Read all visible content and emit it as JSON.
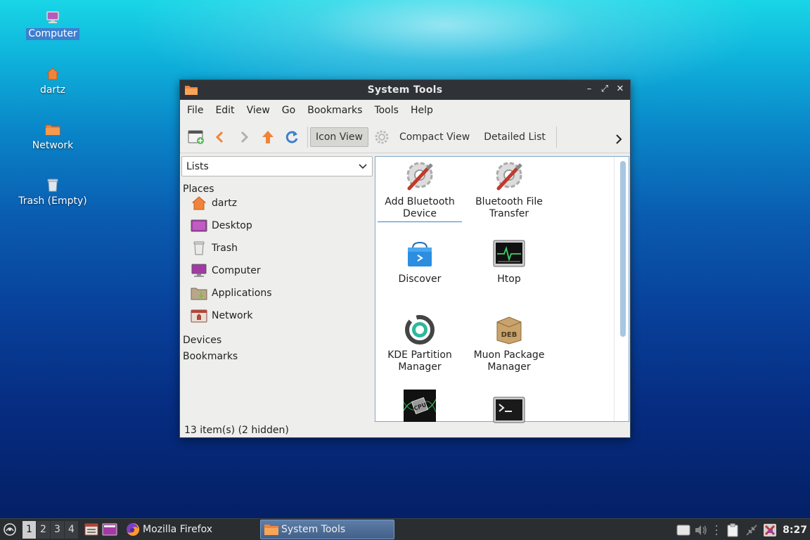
{
  "desktop": {
    "icons": [
      {
        "label": "Computer",
        "icon": "computer-icon",
        "selected": true
      },
      {
        "label": "dartz",
        "icon": "home-folder-icon"
      },
      {
        "label": "Network",
        "icon": "network-folder-icon"
      },
      {
        "label": "Trash (Empty)",
        "icon": "trash-icon"
      }
    ]
  },
  "window": {
    "title": "System Tools",
    "menu": [
      "File",
      "Edit",
      "View",
      "Go",
      "Bookmarks",
      "Tools",
      "Help"
    ],
    "toolbar": {
      "view_modes": [
        "Icon View",
        "Compact View",
        "Detailed List"
      ],
      "active_view": "Icon View"
    },
    "sidepane": {
      "combo_value": "Lists",
      "places_header": "Places",
      "places": [
        {
          "label": "dartz",
          "icon": "home-folder-icon"
        },
        {
          "label": "Desktop",
          "icon": "desktop-icon"
        },
        {
          "label": "Trash",
          "icon": "trash-icon"
        },
        {
          "label": "Computer",
          "icon": "computer-icon"
        },
        {
          "label": "Applications",
          "icon": "applications-icon"
        },
        {
          "label": "Network",
          "icon": "network-icon"
        }
      ],
      "devices_header": "Devices",
      "bookmarks_header": "Bookmarks"
    },
    "files": [
      {
        "label": "Add Bluetooth Device",
        "icon": "tools-icon",
        "focused": true
      },
      {
        "label": "Bluetooth File Transfer",
        "icon": "tools-icon"
      },
      {
        "label": "Discover",
        "icon": "discover-bag-icon"
      },
      {
        "label": "Htop",
        "icon": "system-monitor-icon"
      },
      {
        "label": "KDE Partition Manager",
        "icon": "partition-manager-icon"
      },
      {
        "label": "Muon Package Manager",
        "icon": "deb-package-icon"
      },
      {
        "label": "",
        "icon": "cpu-icon"
      },
      {
        "label": "",
        "icon": "terminal-icon"
      }
    ],
    "status": "13 item(s) (2 hidden)"
  },
  "taskbar": {
    "workspaces": [
      "1",
      "2",
      "3",
      "4"
    ],
    "current_workspace": "1",
    "tasks": [
      {
        "label": "Mozilla Firefox",
        "icon": "firefox-icon",
        "active": false
      },
      {
        "label": "System Tools",
        "icon": "folder-icon",
        "active": true
      }
    ],
    "clock": "8:27"
  },
  "colors": {
    "accent": "#3d7fd1",
    "titlebar": "#2f3337",
    "taskbar": "#2b2e31",
    "folder_orange": "#f0843a"
  }
}
